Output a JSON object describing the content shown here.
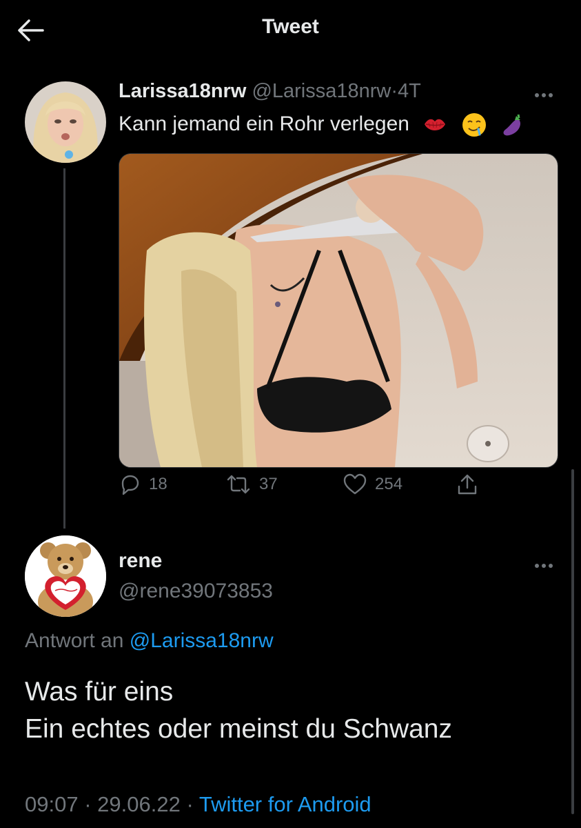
{
  "header": {
    "title": "Tweet"
  },
  "tweet": {
    "display_name": "Larissa18nrw",
    "handle": "@Larissa18nrw",
    "separator": "·",
    "age": "4T",
    "text": "Kann jemand ein Rohr verlegen",
    "emojis": [
      "kiss-mark-icon",
      "drooling-face-icon",
      "eggplant-icon"
    ],
    "stats": {
      "replies": "18",
      "retweets": "37",
      "likes": "254"
    }
  },
  "reply": {
    "display_name": "rene",
    "handle": "@rene39073853",
    "reply_prefix": "Antwort an",
    "reply_to": "@Larissa18nrw",
    "line1": "Was für eins",
    "line2": "Ein echtes oder meinst du Schwanz",
    "time": "09:07",
    "separator": "·",
    "date": "29.06.22",
    "client": "Twitter for Android"
  },
  "colors": {
    "background": "#000000",
    "text": "#e7e9ea",
    "muted": "#71767b",
    "link": "#1d9bf0"
  }
}
